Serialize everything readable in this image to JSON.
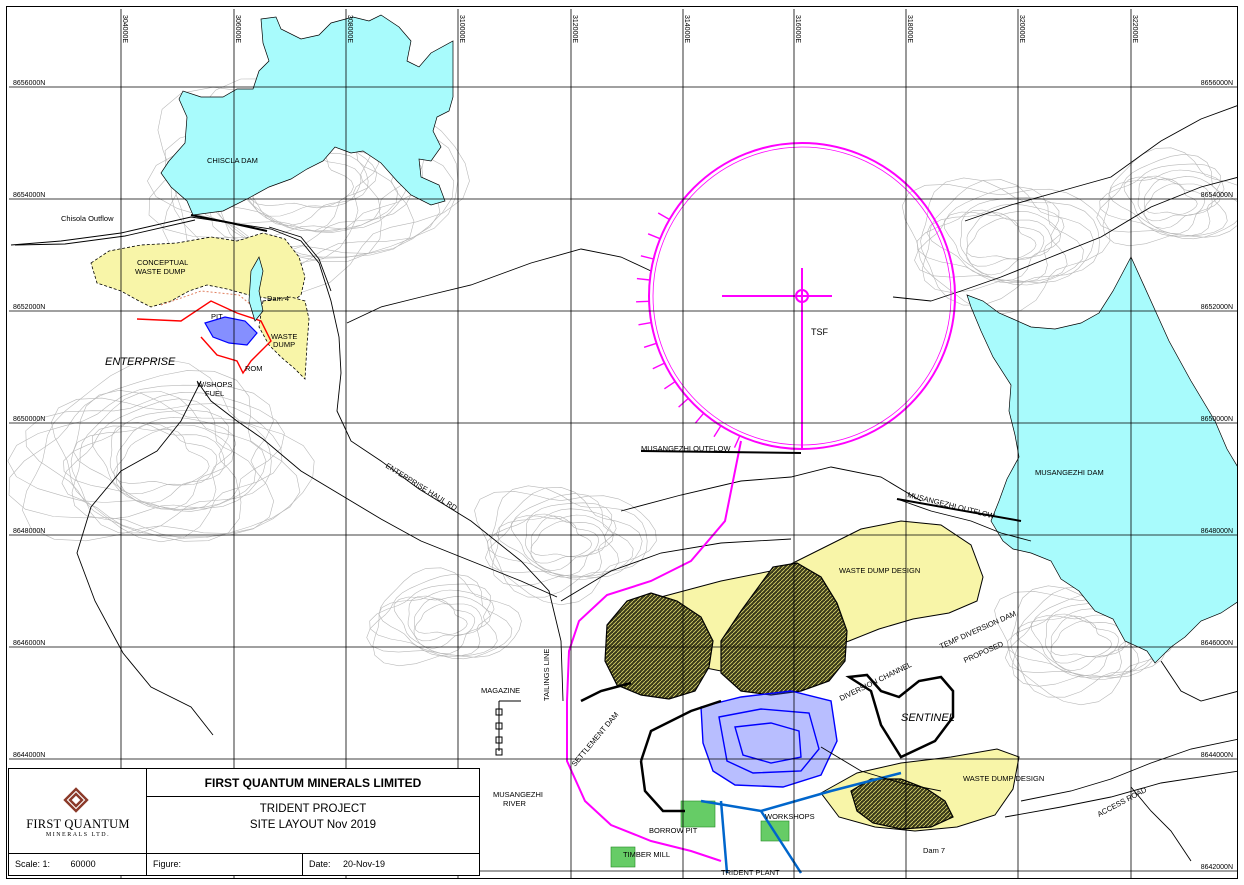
{
  "colors": {
    "water": "#a8fbfc",
    "waste_dump": "#f8f5a8",
    "tsf_outline": "#ff00ff",
    "grid": "#000000",
    "contour": "#b0b0b0",
    "pit_blue": "#0000ff",
    "pit_red": "#ff0000",
    "plant_green": "#66cc66",
    "logo_brown": "#8b3a2a"
  },
  "grid": {
    "eastings": [
      "304000E",
      "306000E",
      "308000E",
      "310000E",
      "312000E",
      "314000E",
      "316000E",
      "318000E",
      "320000E",
      "322000E"
    ],
    "northings": [
      "8656000N",
      "8654000N",
      "8652000N",
      "8650000N",
      "8648000N",
      "8646000N",
      "8644000N",
      "8642000N"
    ]
  },
  "labels": {
    "chiscla_dam": "CHISCLA DAM",
    "chisola_outflow": "Chisola Outflow",
    "conceptual_waste_dump": [
      "CONCEPTUAL",
      "WASTE DUMP"
    ],
    "dam4": "Dam 4",
    "pit": "PIT",
    "waste_dump_small": [
      "WASTE",
      "DUMP"
    ],
    "enterprise": "ENTERPRISE",
    "rom": "ROM",
    "wshops_fuel": [
      "W/SHOPS",
      "FUEL"
    ],
    "tsf": "TSF",
    "musangezhi_outflow_1": "MUSANGEZHI OUTFLOW",
    "musangezhi_outflow_2": "MUSANGEZHI OUTFLOW",
    "musangezhi_dam": "MUSANGEZHI DAM",
    "enterprise_haul_rd": "ENTERPRISE HAUL RD",
    "waste_dump_design_1": "WASTE DUMP DESIGN",
    "waste_dump_design_2": "WASTE DUMP DESIGN",
    "temp_diversion_dam": "TEMP DIVERSION DAM",
    "proposed": "PROPOSED",
    "diversion_channel": "DIVERSION CHANNEL",
    "sentinel": "SENTINEL",
    "magazine": "MAGAZINE",
    "tailings_line": "TAILINGS LINE",
    "settlement_dam": "SETTLEMENT DAM",
    "musangezhi_river": [
      "MUSANGEZHI",
      "RIVER"
    ],
    "borrow_pit": "BORROW PIT",
    "timber_mill": "TIMBER MILL",
    "trident_plant": "TRIDENT PLANT",
    "workshops": "WORKSHOPS",
    "dam7": "Dam 7",
    "access_road": "ACCESS ROAD"
  },
  "title_block": {
    "company": "FIRST QUANTUM MINERALS LIMITED",
    "project": "TRIDENT PROJECT",
    "subtitle": "SITE LAYOUT Nov 2019",
    "logo_name": "FIRST QUANTUM",
    "logo_sub": "MINERALS LTD.",
    "scale_label": "Scale: 1:",
    "scale_value": "60000",
    "figure_label": "Figure:",
    "figure_value": "",
    "date_label": "Date:",
    "date_value": "20-Nov-19"
  }
}
